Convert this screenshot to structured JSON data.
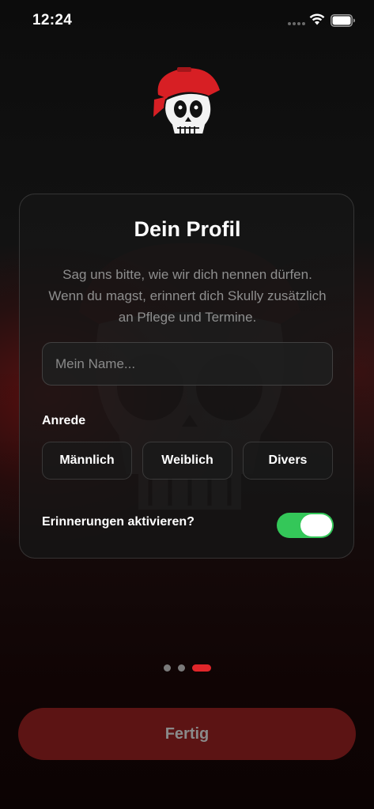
{
  "status_bar": {
    "time": "12:24"
  },
  "profile_card": {
    "title": "Dein Profil",
    "description": "Sag uns bitte, wie wir dich nennen dürfen. Wenn du magst, erinnert dich Skully zusätzlich an Pflege und Termine.",
    "name_input": {
      "value": "",
      "placeholder": "Mein Name..."
    },
    "salutation": {
      "label": "Anrede",
      "options": [
        "Männlich",
        "Weiblich",
        "Divers"
      ]
    },
    "reminders": {
      "label": "Erinnerungen aktivieren?",
      "enabled": true
    }
  },
  "pagination": {
    "total": 3,
    "current": 3
  },
  "finish_button": {
    "label": "Fertig"
  },
  "colors": {
    "accent": "#e0262a",
    "toggle_on": "#34c759",
    "button_disabled": "#5c1414"
  },
  "icons": [
    "wifi-icon",
    "battery-icon",
    "signal-icon",
    "skully-logo"
  ]
}
